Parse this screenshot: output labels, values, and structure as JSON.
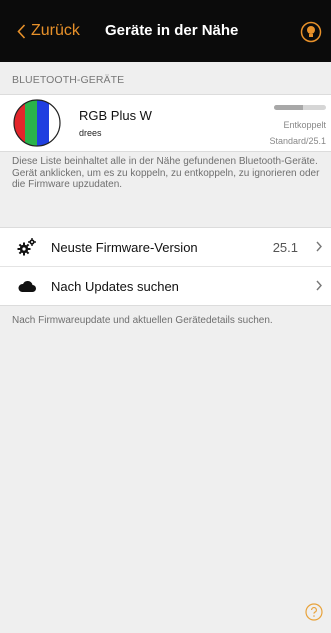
{
  "nav": {
    "back_label": "Zurück",
    "title": "Geräte in der Nähe",
    "accent": "#e8912a"
  },
  "section": {
    "header": "BLUETOOTH-GERÄTE"
  },
  "device": {
    "name": "RGB Plus W",
    "manufacturer": "drees",
    "status": "Entkoppelt",
    "version": "Standard/25.1",
    "signal_fraction": 0.55,
    "icon": "rgb-stripes-icon"
  },
  "description": "Diese Liste beinhaltet alle in der Nähe gefundenen Bluetooth-Geräte. Gerät anklicken, um es zu koppeln, zu entkoppeln, zu ignorieren oder die Firmware upzudaten.",
  "list": {
    "firmware": {
      "label": "Neuste Firmware-Version",
      "value": "25.1",
      "icon": "gears-icon"
    },
    "updates": {
      "label": "Nach Updates suchen",
      "icon": "cloud-icon"
    }
  },
  "footer_note": "Nach Firmwareupdate und aktuellen Gerätedetails suchen.",
  "icons": {
    "help": "help-icon",
    "nav_right": "bluetooth-bulb-icon"
  }
}
